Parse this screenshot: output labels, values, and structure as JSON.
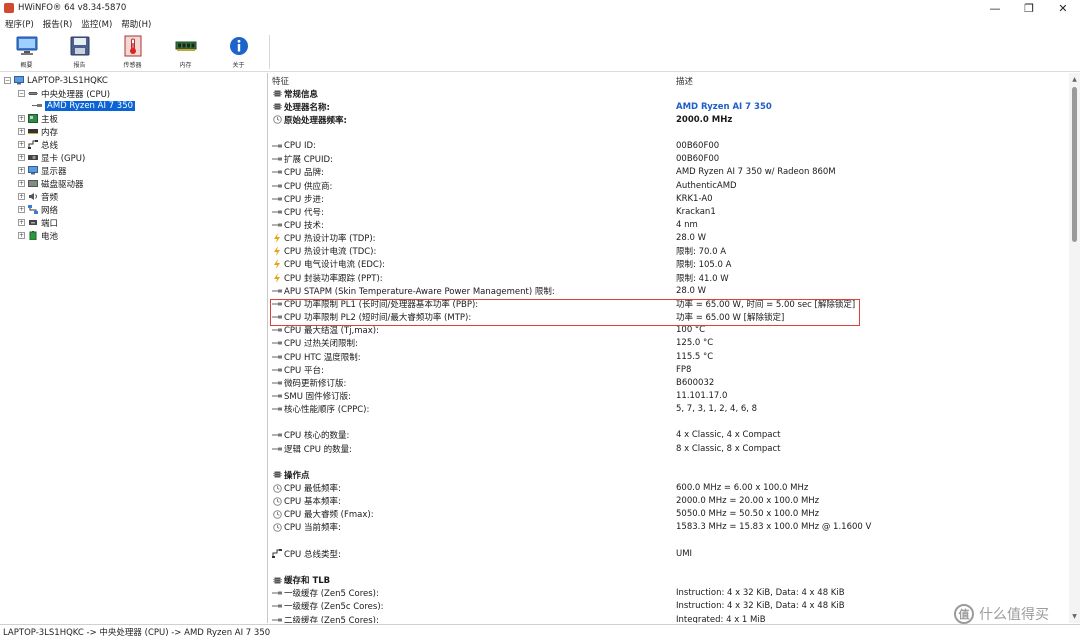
{
  "window": {
    "title": "HWiNFO® 64 v8.34-5870",
    "minimize": "—",
    "maximize": "❐",
    "close": "✕"
  },
  "menu": [
    "程序(P)",
    "报告(R)",
    "监控(M)",
    "帮助(H)"
  ],
  "toolbar": [
    {
      "label": "概要",
      "icon": "monitor-icon"
    },
    {
      "label": "报告",
      "icon": "save-icon"
    },
    {
      "label": "传感器",
      "icon": "thermometer-icon"
    },
    {
      "label": "内存",
      "icon": "memory-icon"
    },
    {
      "label": "关于",
      "icon": "info-icon"
    }
  ],
  "tree": {
    "root": "LAPTOP-3LS1HQKC",
    "items": [
      {
        "label": "中央处理器 (CPU)",
        "expanded": true
      },
      {
        "label": "AMD Ryzen AI 7 350",
        "selected": true
      },
      {
        "label": "主板"
      },
      {
        "label": "内存"
      },
      {
        "label": "总线"
      },
      {
        "label": "显卡 (GPU)"
      },
      {
        "label": "显示器"
      },
      {
        "label": "磁盘驱动器"
      },
      {
        "label": "音频"
      },
      {
        "label": "网络"
      },
      {
        "label": "端口"
      },
      {
        "label": "电池"
      }
    ]
  },
  "columns": {
    "feature": "特征",
    "description": "描述"
  },
  "rows": [
    {
      "type": "section",
      "feature": "常规信息",
      "value": "",
      "icon": "cpu-chip-icon"
    },
    {
      "feature": "处理器名称:",
      "value": "AMD Ryzen AI 7 350",
      "icon": "cpu-chip-icon",
      "bold": true,
      "valueStyle": "blue"
    },
    {
      "feature": "原始处理器频率:",
      "value": "2000.0 MHz",
      "icon": "clock-icon",
      "bold": true,
      "valueStyle": "bold"
    },
    {
      "type": "blank"
    },
    {
      "feature": "CPU ID:",
      "value": "00B60F00",
      "icon": "arrow-icon"
    },
    {
      "feature": "扩展 CPUID:",
      "value": "00B60F00",
      "icon": "arrow-icon"
    },
    {
      "feature": "CPU 品牌:",
      "value": "AMD Ryzen AI 7 350 w/ Radeon 860M",
      "icon": "arrow-icon"
    },
    {
      "feature": "CPU 供应商:",
      "value": "AuthenticAMD",
      "icon": "arrow-icon"
    },
    {
      "feature": "CPU 步进:",
      "value": "KRK1-A0",
      "icon": "arrow-icon"
    },
    {
      "feature": "CPU 代号:",
      "value": "Krackan1",
      "icon": "arrow-icon"
    },
    {
      "feature": "CPU 技术:",
      "value": "4 nm",
      "icon": "arrow-icon"
    },
    {
      "feature": "CPU 热设计功率 (TDP):",
      "value": "28.0 W",
      "icon": "bolt-icon"
    },
    {
      "feature": "CPU 热设计电流 (TDC):",
      "value": "限制: 70.0 A",
      "icon": "bolt-icon"
    },
    {
      "feature": "CPU 电气设计电流 (EDC):",
      "value": "限制: 105.0 A",
      "icon": "bolt-icon"
    },
    {
      "feature": "CPU 封装功率跟踪 (PPT):",
      "value": "限制: 41.0 W",
      "icon": "bolt-icon"
    },
    {
      "feature": "APU STAPM (Skin Temperature-Aware Power Management) 限制:",
      "value": "28.0 W",
      "icon": "arrow-icon"
    },
    {
      "feature": "CPU 功率限制 PL1 (长时间/处理器基本功率 (PBP):",
      "value": "功率 = 65.00 W, 时间 = 5.00 sec [解除锁定]",
      "icon": "arrow-icon"
    },
    {
      "feature": "CPU 功率限制 PL2 (短时间/最大睿频功率 (MTP):",
      "value": "功率 = 65.00 W [解除锁定]",
      "icon": "arrow-icon"
    },
    {
      "feature": "CPU 最大结温 (Tj,max):",
      "value": "100 °C",
      "icon": "arrow-icon"
    },
    {
      "feature": "CPU 过热关闭限制:",
      "value": "125.0 °C",
      "icon": "arrow-icon"
    },
    {
      "feature": "CPU HTC 温度限制:",
      "value": "115.5 °C",
      "icon": "arrow-icon"
    },
    {
      "feature": "CPU 平台:",
      "value": "FP8",
      "icon": "arrow-icon"
    },
    {
      "feature": "微码更新修订版:",
      "value": "B600032",
      "icon": "arrow-icon"
    },
    {
      "feature": "SMU 固件修订版:",
      "value": "11.101.17.0",
      "icon": "arrow-icon"
    },
    {
      "feature": "核心性能顺序 (CPPC):",
      "value": "5, 7, 3, 1, 2, 4, 6, 8",
      "icon": "arrow-icon"
    },
    {
      "type": "blank"
    },
    {
      "feature": "CPU 核心的数量:",
      "value": "4 x Classic, 4 x Compact",
      "icon": "arrow-icon"
    },
    {
      "feature": "逻辑 CPU 的数量:",
      "value": "8 x Classic, 8 x Compact",
      "icon": "arrow-icon"
    },
    {
      "type": "blank"
    },
    {
      "type": "section",
      "feature": "操作点",
      "value": "",
      "icon": "cpu-chip-icon"
    },
    {
      "feature": "CPU 最低频率:",
      "value": "600.0 MHz = 6.00 x 100.0 MHz",
      "icon": "clock-icon"
    },
    {
      "feature": "CPU 基本频率:",
      "value": "2000.0 MHz = 20.00 x 100.0 MHz",
      "icon": "clock-icon"
    },
    {
      "feature": "CPU 最大睿频 (Fmax):",
      "value": "5050.0 MHz = 50.50 x 100.0 MHz",
      "icon": "clock-icon"
    },
    {
      "feature": "CPU 当前频率:",
      "value": "1583.3 MHz = 15.83 x 100.0 MHz @ 1.1600 V",
      "icon": "clock-icon"
    },
    {
      "type": "blank"
    },
    {
      "feature": "CPU 总线类型:",
      "value": "UMI",
      "icon": "bus-icon"
    },
    {
      "type": "blank"
    },
    {
      "type": "section",
      "feature": "缓存和 TLB",
      "value": "",
      "icon": "cpu-chip-icon"
    },
    {
      "feature": "一级缓存 (Zen5 Cores):",
      "value": "Instruction: 4 x 32 KiB, Data: 4 x 48 KiB",
      "icon": "arrow-icon"
    },
    {
      "feature": "一级缓存 (Zen5c Cores):",
      "value": "Instruction: 4 x 32 KiB, Data: 4 x 48 KiB",
      "icon": "arrow-icon"
    },
    {
      "feature": "二级缓存 (Zen5 Cores):",
      "value": "Integrated: 4 x 1 MiB",
      "icon": "arrow-icon"
    }
  ],
  "status": "LAPTOP-3LS1HQKC -> 中央处理器 (CPU) -> AMD Ryzen AI 7 350",
  "watermark": {
    "symbol": "值",
    "text": "什么值得买"
  },
  "colors": {
    "selection": "#0a64d6",
    "highlight_box": "#e0403a",
    "accent_value": "#1f5fc8"
  }
}
